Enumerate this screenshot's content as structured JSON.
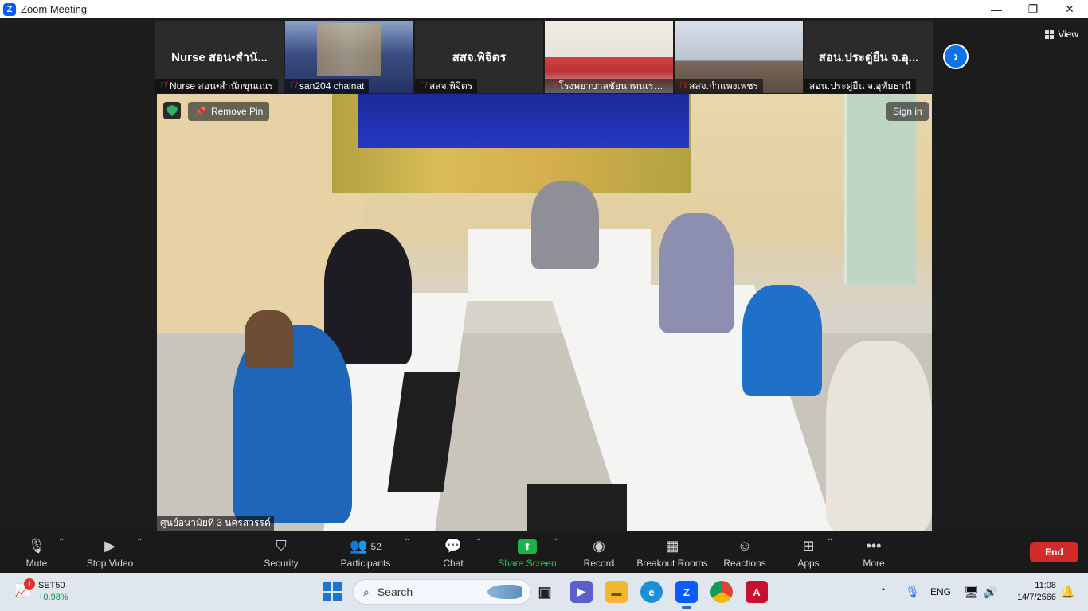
{
  "window": {
    "title": "Zoom Meeting",
    "controls": [
      "—",
      "❐",
      "✕"
    ]
  },
  "view_button": "View",
  "thumbnails": [
    {
      "big_name": "Nurse สอน•สำนั...",
      "caption": "Nurse สอน•สำนักขุนเณร",
      "muted": true,
      "has_video": false
    },
    {
      "big_name": "",
      "caption": "san204 chainat",
      "muted": true,
      "has_video": true
    },
    {
      "big_name": "สสจ.พิจิตร",
      "caption": "สสจ.พิจิตร",
      "muted": true,
      "has_video": false
    },
    {
      "big_name": "",
      "caption": "โรงพยาบาลชัยนาทนเรนทร",
      "muted": true,
      "has_video": true
    },
    {
      "big_name": "",
      "caption": "สสจ.กำแพงเพชร",
      "muted": true,
      "has_video": true
    },
    {
      "big_name": "สอน.ประดู่ยืน จ.อุ...",
      "caption": "สอน.ประดู่ยืน จ.อุทัยธานี",
      "muted": false,
      "has_video": false
    }
  ],
  "video_overlay": {
    "remove_pin": "Remove Pin",
    "sign_in": "Sign in",
    "speaker_name": "ศูนย์อนามัยที่ 3 นครสวรรค์"
  },
  "toolbar": {
    "mute": "Mute",
    "stop_video": "Stop Video",
    "security": "Security",
    "participants": "Participants",
    "participants_count": "52",
    "chat": "Chat",
    "share_screen": "Share Screen",
    "record": "Record",
    "breakout_rooms": "Breakout Rooms",
    "reactions": "Reactions",
    "apps": "Apps",
    "more": "More",
    "end": "End"
  },
  "taskbar": {
    "widget_name": "SET50",
    "widget_change": "+0.98%",
    "widget_badge": "1",
    "search_label": "Search",
    "language": "ENG",
    "time": "11:08",
    "date": "14/7/2566"
  },
  "colors": {
    "accent_blue": "#0e72ed",
    "share_green": "#20b04b",
    "end_red": "#d12b2b",
    "mic_off_red": "#e02828"
  }
}
